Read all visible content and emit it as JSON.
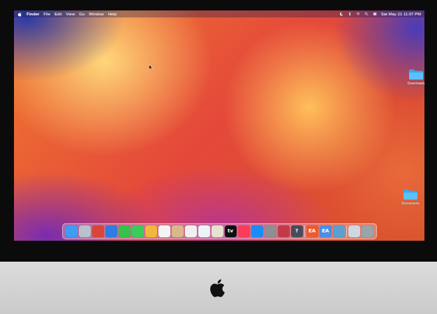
{
  "menu_bar": {
    "app": "Finder",
    "menus": [
      "File",
      "Edit",
      "View",
      "Go",
      "Window",
      "Help"
    ],
    "clock": "Sat May 21 11:07 PM"
  },
  "desktop_icons": [
    {
      "label": "Downloads"
    },
    {
      "label": "Documents"
    }
  ],
  "dock": [
    {
      "kind": "app",
      "color": "#3d9df3"
    },
    {
      "kind": "app",
      "color": "#b9c2cc"
    },
    {
      "kind": "app",
      "color": "#d9453a"
    },
    {
      "kind": "app",
      "color": "#2f7de1"
    },
    {
      "kind": "app",
      "color": "#34c24a"
    },
    {
      "kind": "app",
      "color": "#3ccb5a"
    },
    {
      "kind": "app",
      "color": "#f2b73e"
    },
    {
      "kind": "app",
      "color": "#f4f4f4"
    },
    {
      "kind": "app",
      "color": "#d9b98c"
    },
    {
      "kind": "app",
      "color": "#f0f0f0"
    },
    {
      "kind": "app",
      "color": "#eaf3f7"
    },
    {
      "kind": "app",
      "color": "#e8e0d0"
    },
    {
      "kind": "app",
      "color": "#111111",
      "glyph": "tv"
    },
    {
      "kind": "app",
      "color": "#fa3c5a"
    },
    {
      "kind": "app",
      "color": "#1a8cf5"
    },
    {
      "kind": "app",
      "color": "#8e8e93"
    },
    {
      "kind": "app",
      "color": "#c23a4a"
    },
    {
      "kind": "app",
      "color": "#4a4a5a",
      "glyph": "?"
    },
    {
      "kind": "separator"
    },
    {
      "kind": "app",
      "color": "#f05a28",
      "glyph": "EA"
    },
    {
      "kind": "app",
      "color": "#4a8ee8",
      "glyph": "EA"
    },
    {
      "kind": "app",
      "color": "#5aa0d0"
    },
    {
      "kind": "separator"
    },
    {
      "kind": "app",
      "color": "#cfd8e0"
    },
    {
      "kind": "app",
      "color": "#9aa4ae"
    }
  ]
}
